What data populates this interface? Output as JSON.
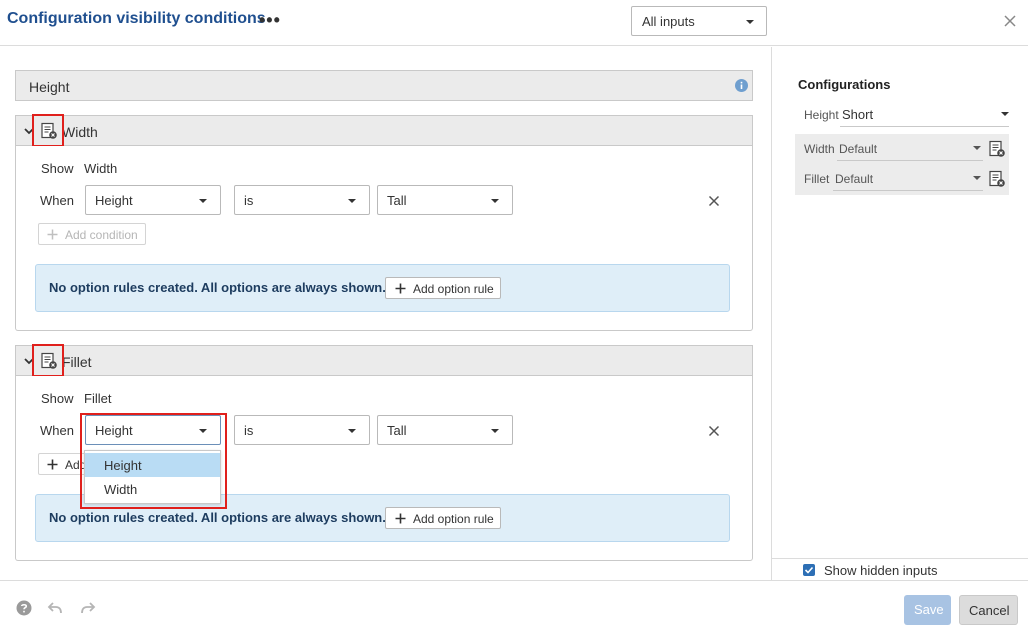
{
  "header": {
    "title": "Configuration visibility conditions",
    "more_label": "•••",
    "filter_select": "All inputs"
  },
  "sections": {
    "height": {
      "label": "Height"
    },
    "width": {
      "label": "Width",
      "show_label": "Show",
      "show_value": "Width",
      "when_label": "When",
      "input_select": "Height",
      "operator_select": "is",
      "value_select": "Tall",
      "add_condition": "Add condition",
      "info_message": "No option rules created. All options are always shown.",
      "add_option_rule": "Add option rule"
    },
    "fillet": {
      "label": "Fillet",
      "show_label": "Show",
      "show_value": "Fillet",
      "when_label": "When",
      "input_select": "Height",
      "operator_select": "is",
      "value_select": "Tall",
      "add_condition_partial": "Add",
      "info_message": "No option rules created. All options are always shown.",
      "add_option_rule": "Add option rule"
    }
  },
  "dropdown_menu": {
    "options": [
      "Height",
      "Width"
    ],
    "selected": "Height"
  },
  "configurations": {
    "title": "Configurations",
    "rows": [
      {
        "name": "Height",
        "value": "Short"
      },
      {
        "name": "Width",
        "value": "Default"
      },
      {
        "name": "Fillet",
        "value": "Default"
      }
    ],
    "show_hidden_label": "Show hidden inputs",
    "show_hidden_checked": true
  },
  "footer": {
    "save": "Save",
    "cancel": "Cancel"
  },
  "colors": {
    "title_blue": "#1f4f8f",
    "highlight_red": "#e0201c",
    "info_bg": "#dfeef8",
    "menu_selected": "#b9dcf4",
    "checkbox_blue": "#2d6fb5",
    "save_disabled": "#a8c3e3"
  }
}
